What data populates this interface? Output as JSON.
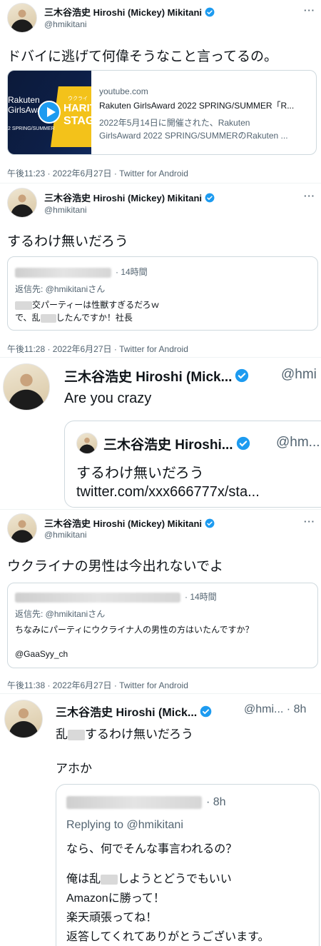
{
  "tweet1": {
    "name": "三木谷浩史 Hiroshi (Mickey) Mikitani",
    "handle": "@hmikitani",
    "more": "···",
    "text": "ドバイに逃げて何偉そうなこと言ってるの。",
    "link": {
      "thumb_text_1": "Rakuten",
      "thumb_text_2": "GirlsAward",
      "thumb_text_3": "2 SPRING/SUMMER",
      "thumb_text_4": "ウクライナ",
      "thumb_text_5": "HARIT",
      "thumb_text_6": "STAG",
      "domain": "youtube.com",
      "title": "Rakuten GirlsAward 2022 SPRING/SUMMER「R...",
      "desc_1": "2022年5月14日に開催された、Rakuten",
      "desc_2": "GirlsAward 2022 SPRING/SUMMERのRakuten ..."
    },
    "meta": "午後11:23 · 2022年6月27日 · Twitter for Android"
  },
  "tweet2": {
    "name": "三木谷浩史 Hiroshi (Mickey) Mikitani",
    "handle": "@hmikitani",
    "more": "···",
    "text": "するわけ無いだろう",
    "quote": {
      "time": "· 14時間",
      "reply_to": "返信先: @hmikitaniさん",
      "line1_suffix": "交パーティーは性獣すぎるだろｗ",
      "line2_prefix": "で、乱",
      "line2_suffix": "したんですか！社長"
    },
    "meta": "午後11:28 · 2022年6月27日 · Twitter for Android"
  },
  "tweet3": {
    "name": "三木谷浩史 Hiroshi (Mick...",
    "handle": "@hmi",
    "text": "Are you crazy",
    "quote": {
      "name": "三木谷浩史 Hiroshi...",
      "handle": "@hm...",
      "text": "するわけ無いだろう",
      "link": "twitter.com/xxx666777x/sta..."
    }
  },
  "tweet4": {
    "name": "三木谷浩史 Hiroshi (Mickey) Mikitani",
    "handle": "@hmikitani",
    "more": "···",
    "text": "ウクライナの男性は今出れないでよ",
    "quote": {
      "time": "· 14時間",
      "reply_to": "返信先: @hmikitaniさん",
      "line1": "ちなみにパーティにウクライナ人の男性の方はいたんですか？",
      "mention": "@GaaSyy_ch"
    },
    "meta": "午後11:38 · 2022年6月27日 · Twitter for Android"
  },
  "tweet5": {
    "name": "三木谷浩史 Hiroshi (Mick...",
    "handle": "@hmi... · 8h",
    "text_prefix": "乱",
    "text_suffix": "するわけ無いだろう",
    "text2": "アホか",
    "quote": {
      "time": "· 8h",
      "reply_to": "Replying to @hmikitani",
      "line1": "なら、何でそんな事言われるの？",
      "line2_prefix": "俺は乱",
      "line2_suffix": "しようとどうでもいい",
      "line3": "Amazonに勝って！",
      "line4": "楽天頑張ってね！",
      "line5": "返答してくれてありがとうございます。"
    }
  },
  "colors": {
    "verified": "#1d9bf0",
    "text": "#0f1419",
    "muted": "#536471",
    "border": "#cfd9de"
  }
}
